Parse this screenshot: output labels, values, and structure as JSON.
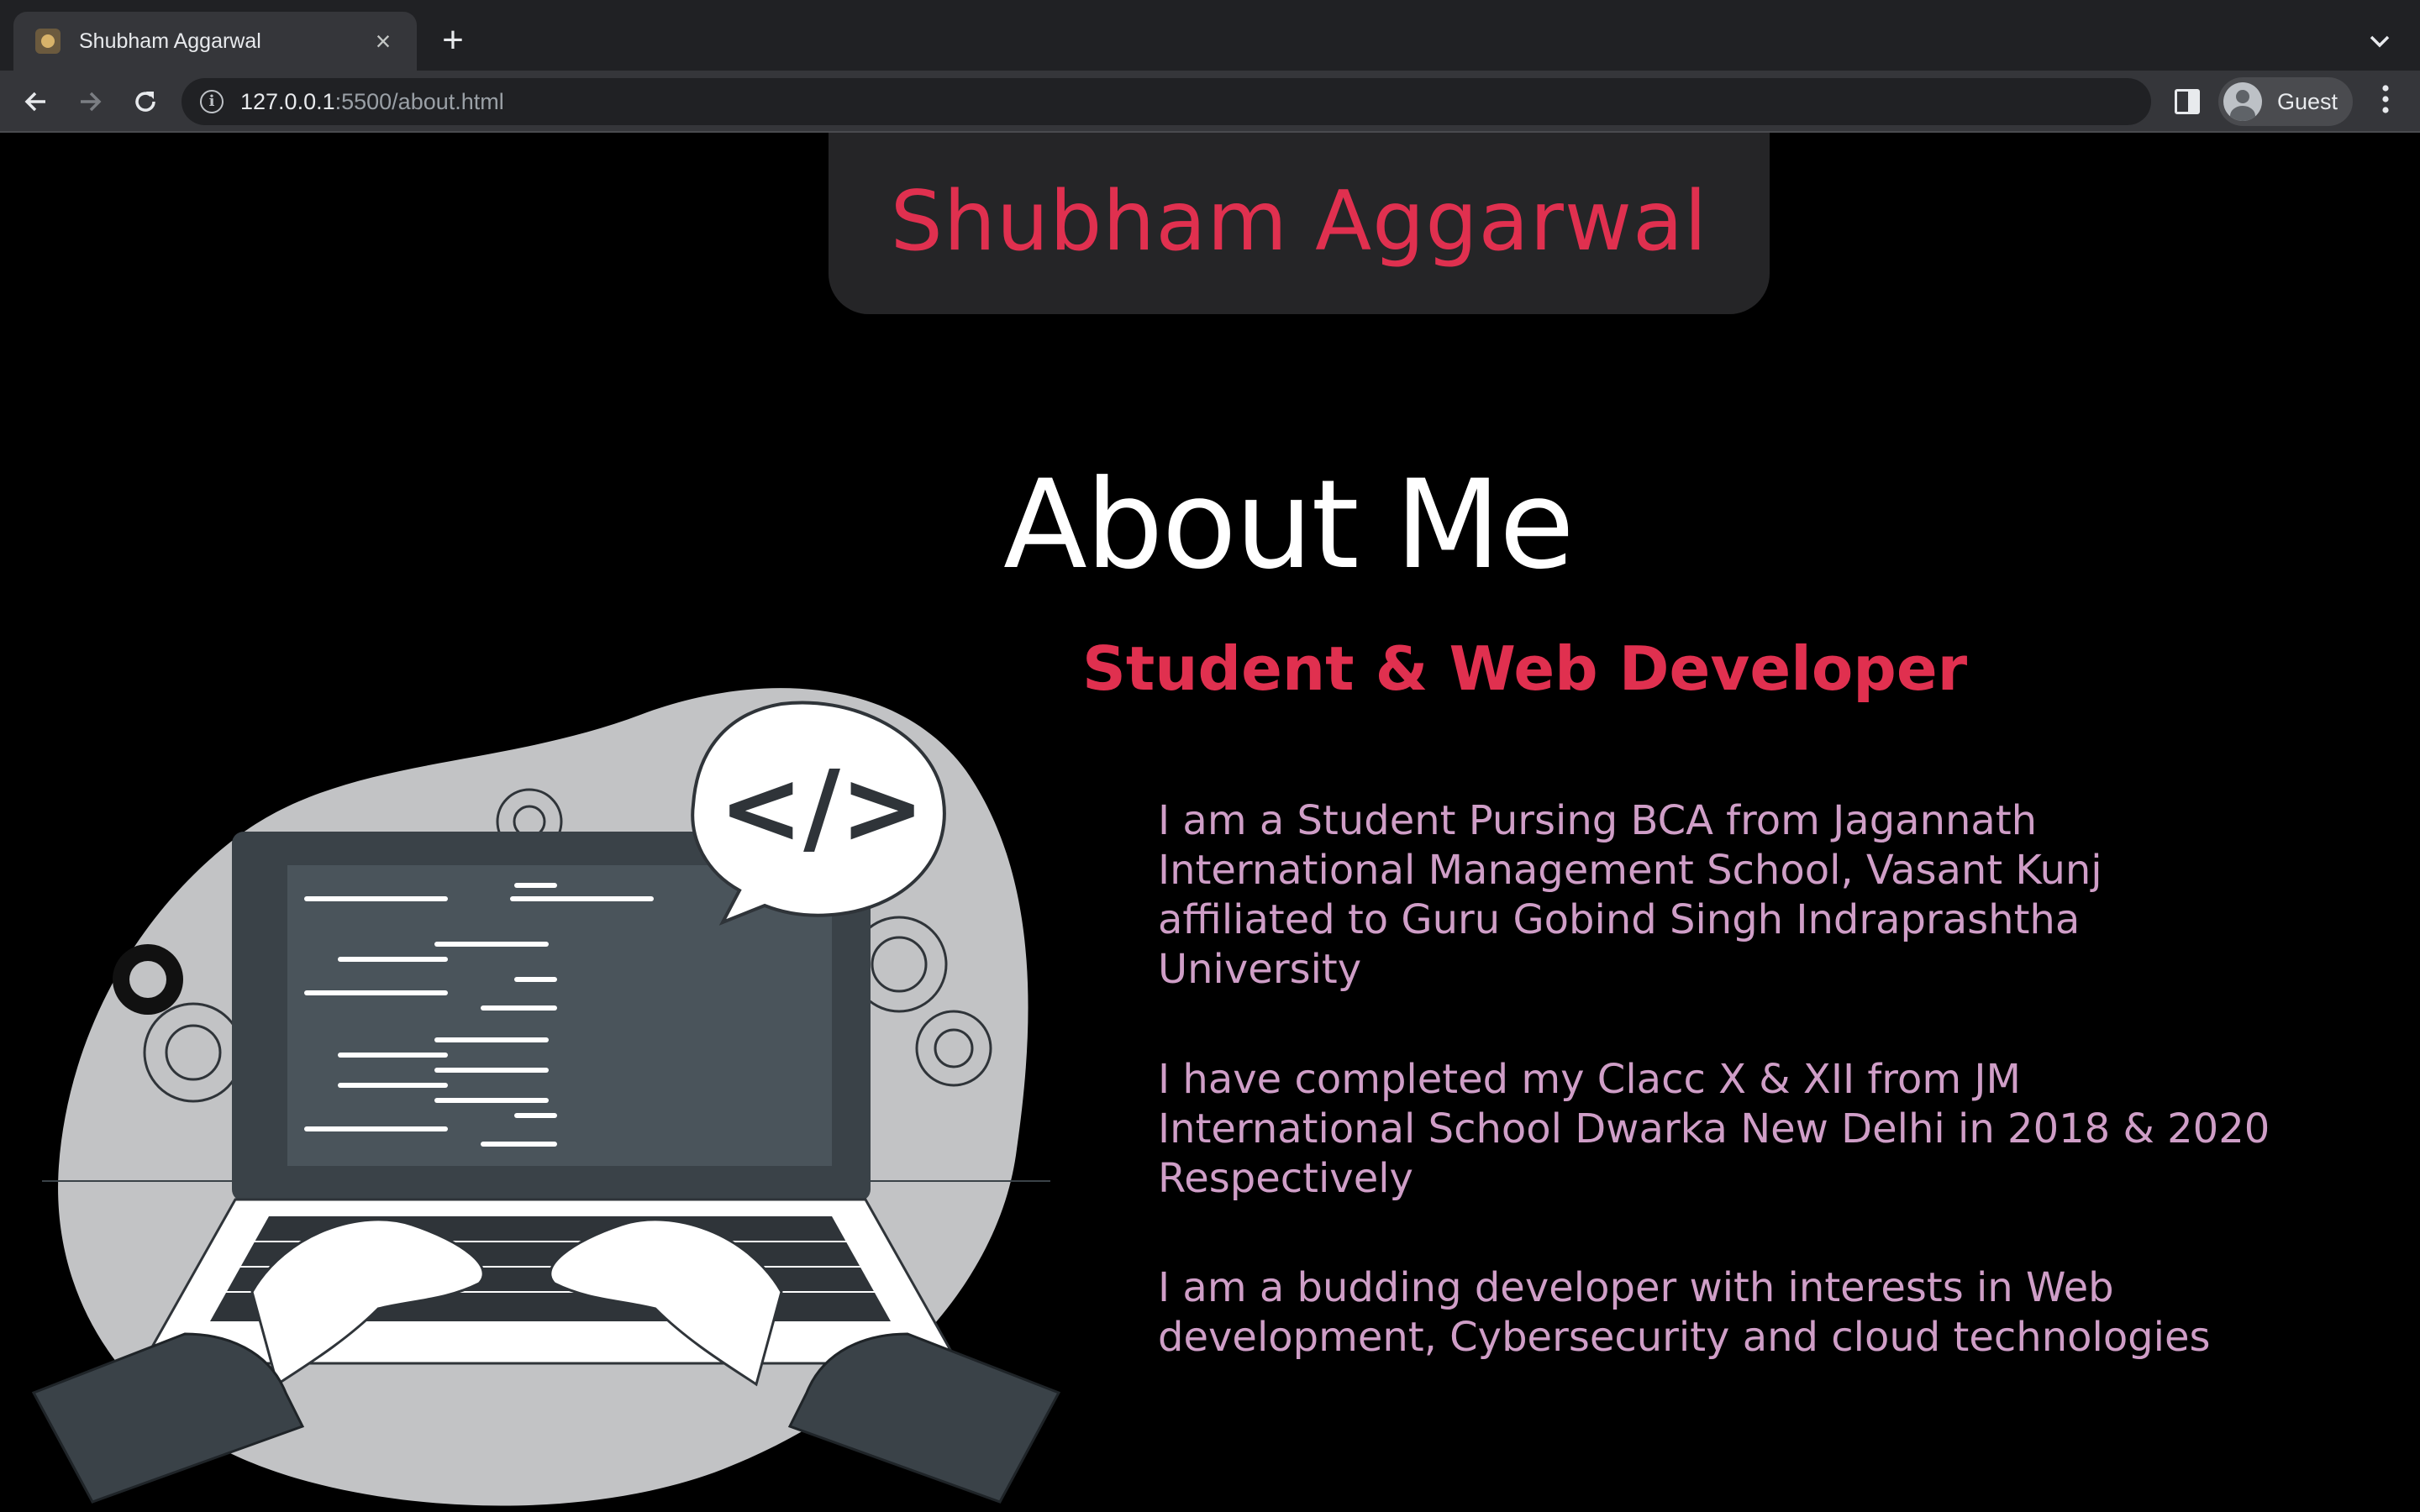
{
  "browser": {
    "tab_title": "Shubham Aggarwal",
    "tab_close": "×",
    "new_tab": "+",
    "url_host": "127.0.0.1",
    "url_path": ":5500/about.html",
    "profile_label": "Guest"
  },
  "page": {
    "site_name": "Shubham Aggarwal",
    "heading": "About Me",
    "subheading": "Student & Web Developer",
    "paragraphs": [
      "I am a Student Pursing BCA from Jagannath International Management School, Vasant Kunj affiliated to Guru Gobind Singh Indraprashtha University",
      "I have completed my Clacc X & XII from JM International School Dwarka New Delhi in 2018 & 2020 Respectively",
      "I am a budding developer with interests in Web development, Cybersecurity and cloud technologies"
    ],
    "illustration_code_symbol": "</>"
  },
  "colors": {
    "accent": "#e0304f",
    "paragraph": "#cf9ec7",
    "background": "#000000",
    "card": "#252527"
  }
}
